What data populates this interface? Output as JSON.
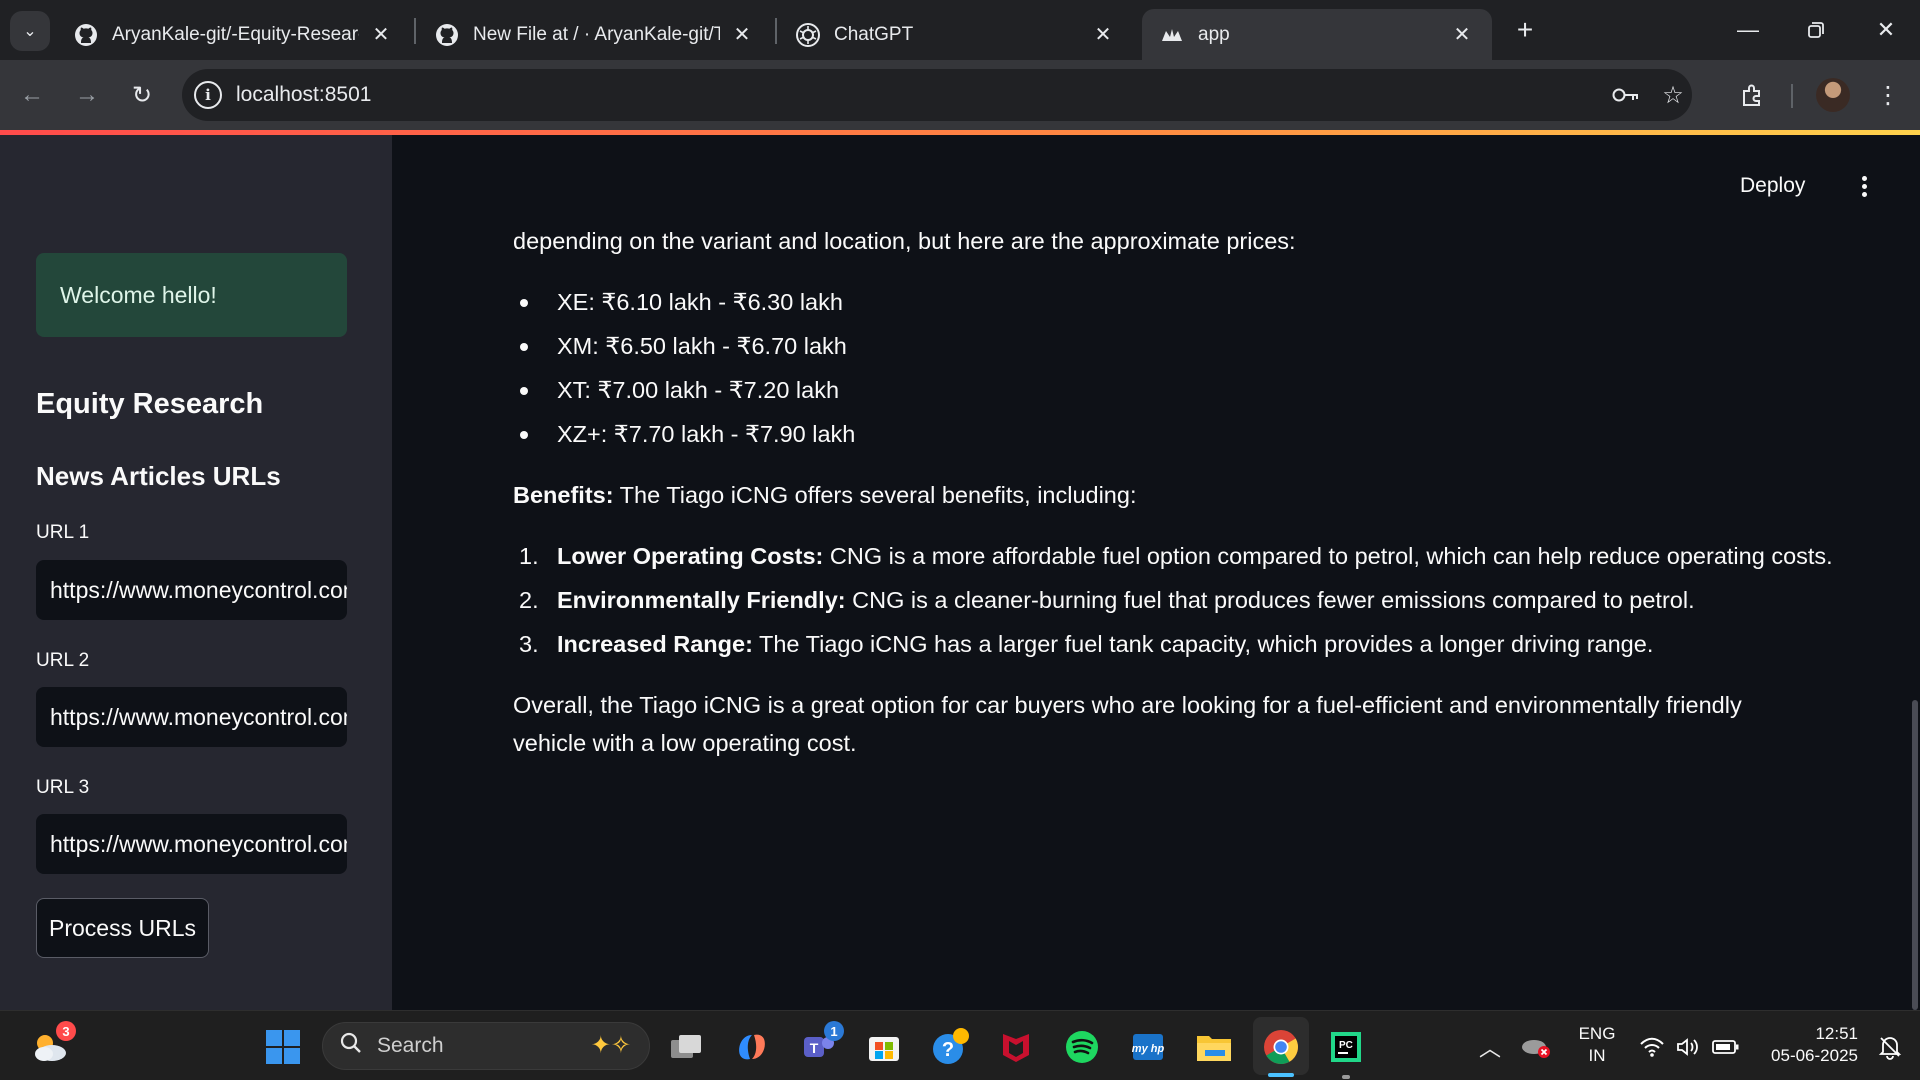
{
  "browser": {
    "tabs": [
      {
        "title": "AryanKale-git/-Equity-Research",
        "icon": "github-icon"
      },
      {
        "title": "New File at / · AryanKale-git/Te",
        "icon": "github-icon"
      },
      {
        "title": "ChatGPT",
        "icon": "chatgpt-icon"
      },
      {
        "title": "app",
        "icon": "streamlit-icon"
      }
    ],
    "address": "localhost:8501",
    "accent_colors": {
      "progress": "#ff8c42",
      "active_tab": "#35363a"
    }
  },
  "app": {
    "header": {
      "deploy_label": "Deploy"
    },
    "sidebar": {
      "welcome": "Welcome hello!",
      "title": "Equity Research",
      "section_title": "News Articles URLs",
      "url_fields": [
        {
          "label": "URL 1",
          "value": "https://www.moneycontrol.com"
        },
        {
          "label": "URL 2",
          "value": "https://www.moneycontrol.com"
        },
        {
          "label": "URL 3",
          "value": "https://www.moneycontrol.com"
        }
      ],
      "process_label": "Process URLs"
    },
    "answer": {
      "intro": "depending on the variant and location, but here are the approximate prices:",
      "prices": [
        "XE: ₹6.10 lakh - ₹6.30 lakh",
        "XM: ₹6.50 lakh - ₹6.70 lakh",
        "XT: ₹7.00 lakh - ₹7.20 lakh",
        "XZ+: ₹7.70 lakh - ₹7.90 lakh"
      ],
      "benefits_label": "Benefits:",
      "benefits_intro": " The Tiago iCNG offers several benefits, including:",
      "benefits": [
        {
          "num": "1.",
          "title": "Lower Operating Costs:",
          "text": " CNG is a more affordable fuel option compared to petrol, which can help reduce operating costs."
        },
        {
          "num": "2.",
          "title": "Environmentally Friendly:",
          "text": " CNG is a cleaner-burning fuel that produces fewer emissions compared to petrol."
        },
        {
          "num": "3.",
          "title": "Increased Range:",
          "text": " The Tiago iCNG has a larger fuel tank capacity, which provides a longer driving range."
        }
      ],
      "conclusion": "Overall, the Tiago iCNG is a great option for car buyers who are looking for a fuel-efficient and environmentally friendly vehicle with a low operating cost."
    }
  },
  "taskbar": {
    "weather_badge": "3",
    "search_label": "Search",
    "teams_badge": "1",
    "lang_top": "ENG",
    "lang_bottom": "IN",
    "time": "12:51",
    "date": "05-06-2025"
  }
}
